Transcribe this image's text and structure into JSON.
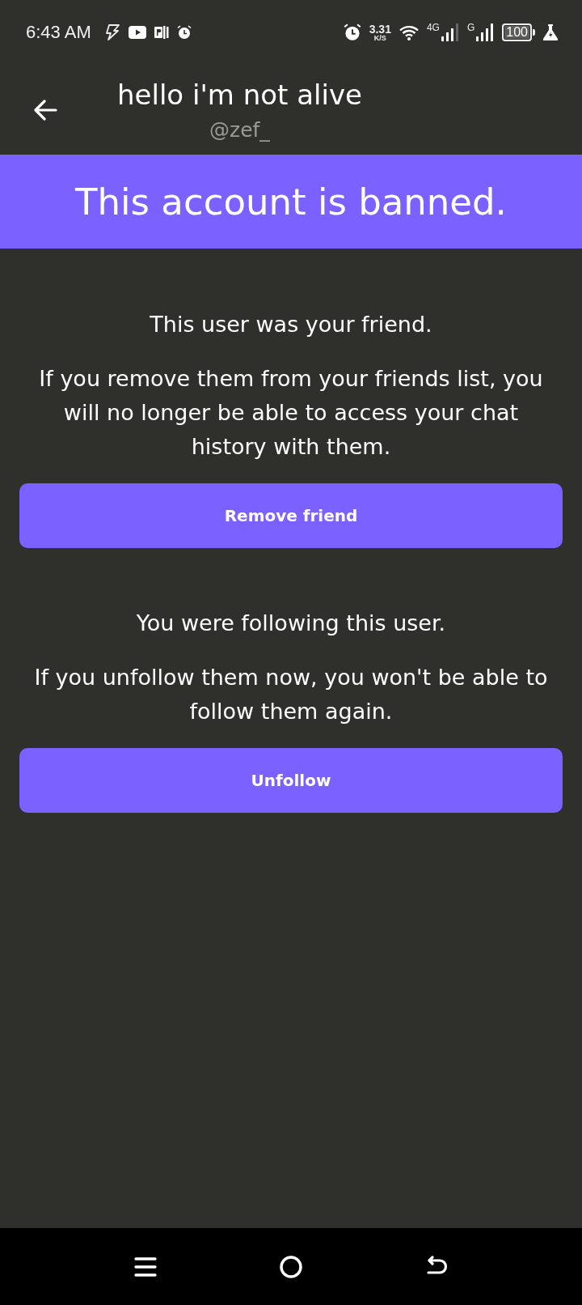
{
  "status_bar": {
    "time": "6:43 AM",
    "net_speed": "3.31",
    "net_unit": "K/S",
    "network_1": "4G",
    "network_2": "G",
    "battery": "100"
  },
  "header": {
    "title": "hello i'm not alive",
    "handle": "@zef_"
  },
  "banner": {
    "text": "This account is banned."
  },
  "sections": [
    {
      "heading": "This user was your friend.",
      "body": "If you remove them from your friends list, you will no longer be able to access your chat history with them.",
      "button": "Remove friend"
    },
    {
      "heading": "You were following this user.",
      "body": "If you unfollow them now, you won't be able to follow them again.",
      "button": "Unfollow"
    }
  ]
}
